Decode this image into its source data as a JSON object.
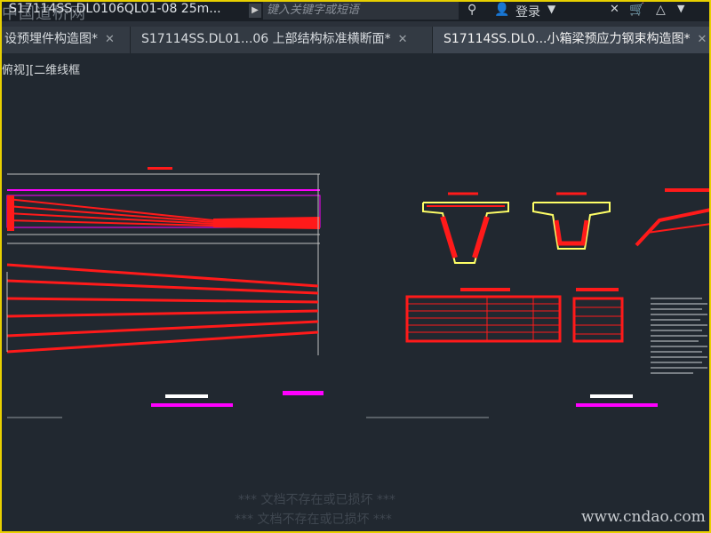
{
  "titlebar": {
    "watermark": "中国道桥网",
    "doc_title": "S17114SS.DL0106QL01-08 25m...",
    "search_placeholder": "键入关键字或短语",
    "login_label": "登录"
  },
  "tabs": [
    {
      "label": "设预埋件构造图*",
      "active": false
    },
    {
      "label": "S17114SS.DL01...06 上部结构标准横断面*",
      "active": false
    },
    {
      "label": "S17114SS.DL0...小箱梁预应力钢束构造图*",
      "active": true
    }
  ],
  "viewport": {
    "view_label": "俯视][二维线框"
  },
  "footer": {
    "faint_line_1": "*** 文档不存在或已损坏 ***",
    "faint_line_2": "*** 文档不存在或已损坏 ***",
    "site": "www.cndao.com"
  },
  "colors": {
    "canvas": "#212830",
    "strand": "#ff1a1a",
    "magenta": "#ff00ff",
    "frame": "#e8d000"
  }
}
